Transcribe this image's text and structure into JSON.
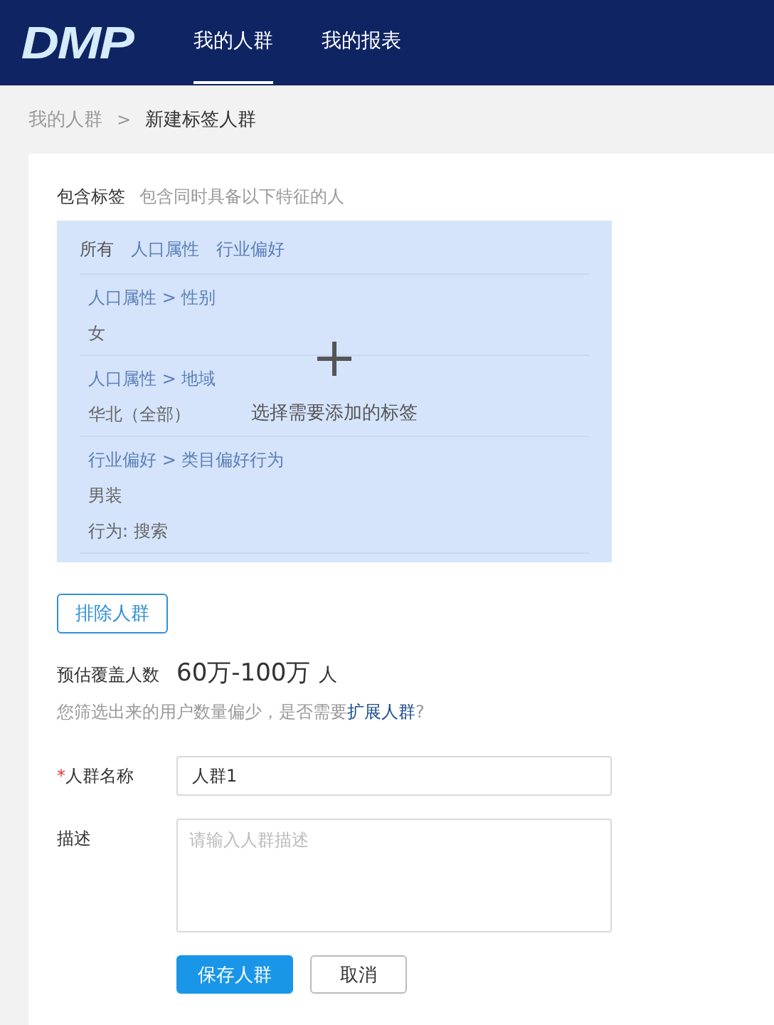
{
  "header": {
    "logo": "DMP",
    "nav": [
      {
        "label": "我的人群",
        "selected": true
      },
      {
        "label": "我的报表",
        "selected": false
      }
    ]
  },
  "breadcrumb": {
    "items": [
      "我的人群",
      "新建标签人群"
    ],
    "separator": ">"
  },
  "include": {
    "title": "包含标签",
    "hint": "包含同时具备以下特征的人",
    "tabs": [
      {
        "label": "所有",
        "selected": true
      },
      {
        "label": "人口属性",
        "selected": false
      },
      {
        "label": "行业偏好",
        "selected": false
      }
    ],
    "groups": [
      {
        "path": [
          "人口属性",
          "性别"
        ],
        "values": [
          "女"
        ]
      },
      {
        "path": [
          "人口属性",
          "地域"
        ],
        "values": [
          "华北（全部）"
        ]
      },
      {
        "path": [
          "行业偏好",
          "类目偏好行为"
        ],
        "values": [
          "男装",
          "行为: 搜索"
        ]
      }
    ],
    "overlay_text": "选择需要添加的标签"
  },
  "exclude_button": "排除人群",
  "estimate": {
    "label": "预估覆盖人数",
    "value": "60万-100万",
    "unit": "人"
  },
  "notice": {
    "text": "您筛选出来的用户数量偏少，是否需要",
    "link": "扩展人群",
    "end": "?"
  },
  "form": {
    "name": {
      "label": "人群名称",
      "required": true,
      "required_mark": "*",
      "value": "人群1"
    },
    "description": {
      "label": "描述",
      "placeholder": "请输入人群描述"
    }
  },
  "buttons": [
    {
      "label": "保存人群",
      "kind": "primary"
    },
    {
      "label": "取消",
      "kind": "default"
    }
  ]
}
